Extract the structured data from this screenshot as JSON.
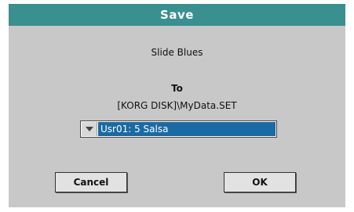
{
  "dialog": {
    "title": "Save",
    "item_name": "Slide Blues",
    "to_label": "To",
    "path": "[KORG DISK]\\MyData.SET",
    "destination": {
      "selected": "Usr01: 5 Salsa"
    },
    "buttons": {
      "cancel": "Cancel",
      "ok": "OK"
    }
  },
  "colors": {
    "title_bar": "#3a8f8f",
    "dialog_bg": "#c8c8c8",
    "selection": "#1a6aa3"
  }
}
